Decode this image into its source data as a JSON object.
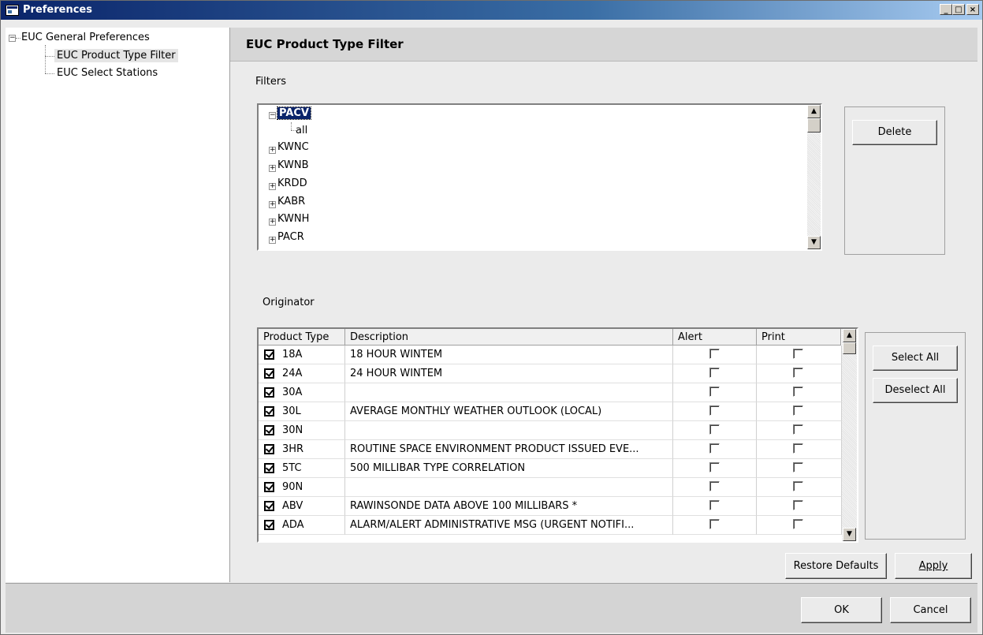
{
  "window": {
    "title": "Preferences",
    "buttons": [
      "_",
      "□",
      "×"
    ]
  },
  "nav": {
    "root": "EUC General Preferences",
    "children": [
      "EUC Product Type Filter",
      "EUC Select Stations"
    ],
    "selected": "EUC Product Type Filter"
  },
  "main": {
    "header": "EUC Product Type Filter",
    "filters_label": "Filters",
    "originator_label": "Originator"
  },
  "filters_tree": {
    "expanded": {
      "label": "PACV",
      "child": "all"
    },
    "collapsed": [
      "KWNC",
      "KWNB",
      "KRDD",
      "KABR",
      "KWNH",
      "PACR"
    ]
  },
  "buttons": {
    "delete": "Delete",
    "select_all": "Select All",
    "deselect_all": "Deselect All",
    "restore_defaults": "Restore Defaults",
    "apply": "Apply",
    "ok": "OK",
    "cancel": "Cancel"
  },
  "table": {
    "columns": [
      "Product Type",
      "Description",
      "Alert",
      "Print"
    ],
    "rows": [
      {
        "type": "18A",
        "description": "18 HOUR WINTEM",
        "checked": true,
        "alert": false,
        "print": false
      },
      {
        "type": "24A",
        "description": "24 HOUR WINTEM",
        "checked": true,
        "alert": false,
        "print": false
      },
      {
        "type": "30A",
        "description": "",
        "checked": true,
        "alert": false,
        "print": false
      },
      {
        "type": "30L",
        "description": "AVERAGE MONTHLY WEATHER OUTLOOK (LOCAL)",
        "checked": true,
        "alert": false,
        "print": false
      },
      {
        "type": "30N",
        "description": "",
        "checked": true,
        "alert": false,
        "print": false
      },
      {
        "type": "3HR",
        "description": "ROUTINE SPACE ENVIRONMENT PRODUCT ISSUED EVE...",
        "checked": true,
        "alert": false,
        "print": false
      },
      {
        "type": "5TC",
        "description": "500 MILLIBAR TYPE CORRELATION",
        "checked": true,
        "alert": false,
        "print": false
      },
      {
        "type": "90N",
        "description": "",
        "checked": true,
        "alert": false,
        "print": false
      },
      {
        "type": "ABV",
        "description": "RAWINSONDE DATA ABOVE 100 MILLIBARS *",
        "checked": true,
        "alert": false,
        "print": false
      },
      {
        "type": "ADA",
        "description": "ALARM/ALERT ADMINISTRATIVE MSG (URGENT NOTIFI...",
        "checked": true,
        "alert": false,
        "print": false
      }
    ]
  },
  "colors": {
    "title_bar": "#0a246a",
    "selection": "#0a246a"
  }
}
